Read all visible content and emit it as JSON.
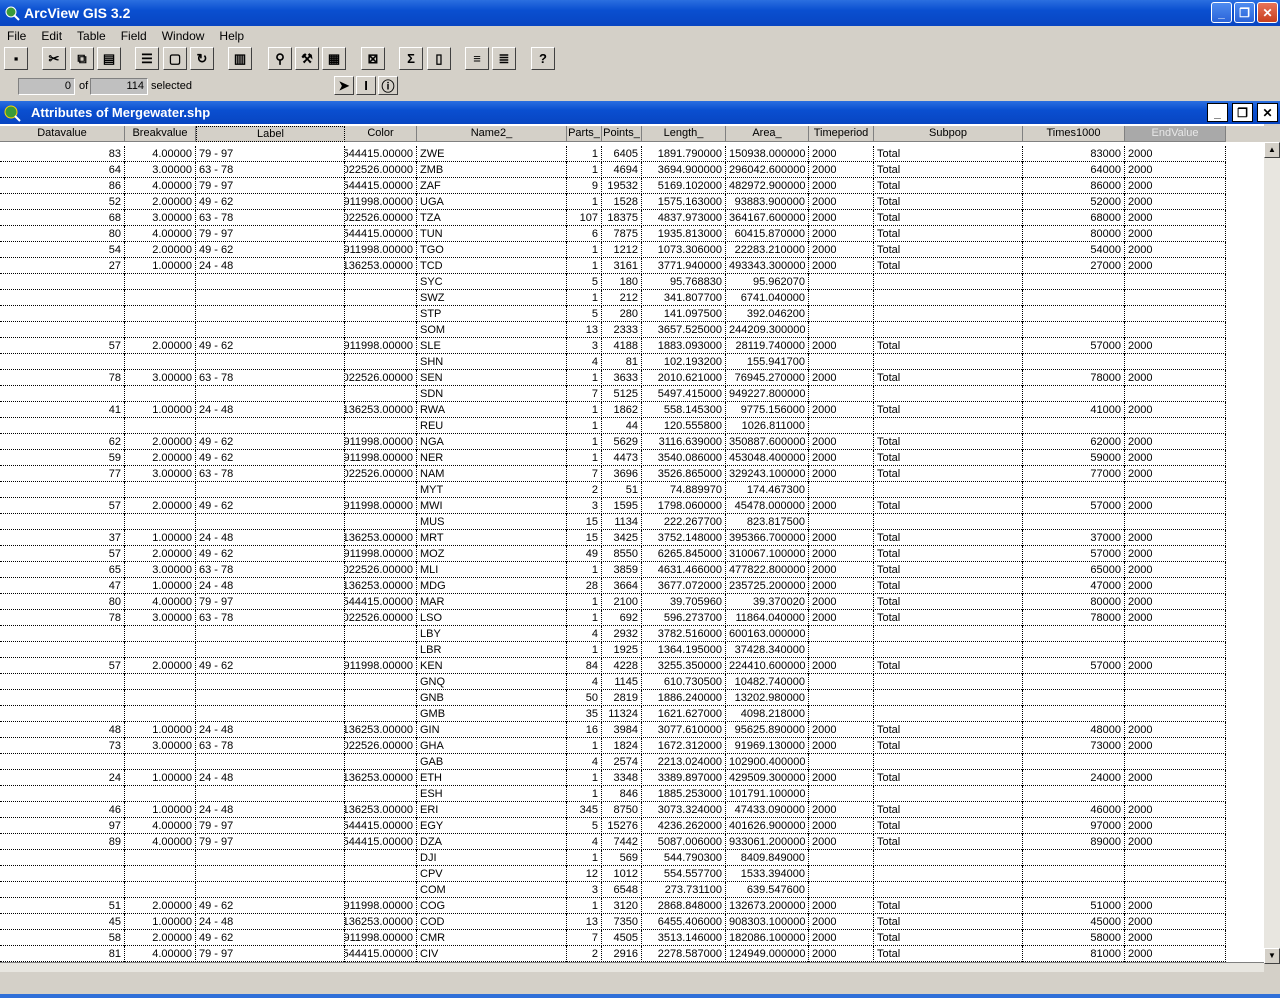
{
  "app": {
    "title": "ArcView GIS 3.2",
    "brand_color": "#0a4fd0"
  },
  "menu": [
    "File",
    "Edit",
    "Table",
    "Field",
    "Window",
    "Help"
  ],
  "toolbar": {
    "icons": [
      "save-icon",
      "cut-icon",
      "copy-icon",
      "paste-icon",
      "table-properties-icon",
      "select-all-icon",
      "refresh-icon",
      "chart-icon",
      "find-icon",
      "query-icon",
      "promote-icon",
      "field-calc-icon",
      "sum-icon",
      "summarize-icon",
      "sort-ascending-icon",
      "sort-descending-icon",
      "help-icon"
    ],
    "tools": [
      "pointer-tool-icon",
      "edit-tool-icon",
      "identify-tool-icon"
    ]
  },
  "status": {
    "selected_count": "0",
    "of_label": "of",
    "total_count": "114",
    "selected_label": "selected"
  },
  "table": {
    "title": "Attributes of Mergewater.shp",
    "columns": [
      "Datavalue",
      "Breakvalue",
      "Label",
      "Color",
      "Name2_",
      "Parts_",
      "Points_",
      "Length_",
      "Area_",
      "Timeperiod",
      "Subpop",
      "Times1000",
      "EndValue"
    ],
    "rows": [
      [
        "83",
        "4.00000",
        "79 - 97",
        "544415.00000",
        "ZWE",
        "1",
        "6405",
        "1891.790000",
        "150938.000000",
        "2000",
        "Total",
        "83000",
        "2000"
      ],
      [
        "64",
        "3.00000",
        "63 - 78",
        "022526.00000",
        "ZMB",
        "1",
        "4694",
        "3694.900000",
        "296042.600000",
        "2000",
        "Total",
        "64000",
        "2000"
      ],
      [
        "86",
        "4.00000",
        "79 - 97",
        "544415.00000",
        "ZAF",
        "9",
        "19532",
        "5169.102000",
        "482972.900000",
        "2000",
        "Total",
        "86000",
        "2000"
      ],
      [
        "52",
        "2.00000",
        "49 - 62",
        "911998.00000",
        "UGA",
        "1",
        "1528",
        "1575.163000",
        "93883.900000",
        "2000",
        "Total",
        "52000",
        "2000"
      ],
      [
        "68",
        "3.00000",
        "63 - 78",
        "022526.00000",
        "TZA",
        "107",
        "18375",
        "4837.973000",
        "364167.600000",
        "2000",
        "Total",
        "68000",
        "2000"
      ],
      [
        "80",
        "4.00000",
        "79 - 97",
        "544415.00000",
        "TUN",
        "6",
        "7875",
        "1935.813000",
        "60415.870000",
        "2000",
        "Total",
        "80000",
        "2000"
      ],
      [
        "54",
        "2.00000",
        "49 - 62",
        "911998.00000",
        "TGO",
        "1",
        "1212",
        "1073.306000",
        "22283.210000",
        "2000",
        "Total",
        "54000",
        "2000"
      ],
      [
        "27",
        "1.00000",
        "24 - 48",
        "136253.00000",
        "TCD",
        "1",
        "3161",
        "3771.940000",
        "493343.300000",
        "2000",
        "Total",
        "27000",
        "2000"
      ],
      [
        "",
        "",
        "",
        "",
        "SYC",
        "5",
        "180",
        "95.768830",
        "95.962070",
        "",
        "",
        "",
        ""
      ],
      [
        "",
        "",
        "",
        "",
        "SWZ",
        "1",
        "212",
        "341.807700",
        "6741.040000",
        "",
        "",
        "",
        ""
      ],
      [
        "",
        "",
        "",
        "",
        "STP",
        "5",
        "280",
        "141.097500",
        "392.046200",
        "",
        "",
        "",
        ""
      ],
      [
        "",
        "",
        "",
        "",
        "SOM",
        "13",
        "2333",
        "3657.525000",
        "244209.300000",
        "",
        "",
        "",
        ""
      ],
      [
        "57",
        "2.00000",
        "49 - 62",
        "911998.00000",
        "SLE",
        "3",
        "4188",
        "1883.093000",
        "28119.740000",
        "2000",
        "Total",
        "57000",
        "2000"
      ],
      [
        "",
        "",
        "",
        "",
        "SHN",
        "4",
        "81",
        "102.193200",
        "155.941700",
        "",
        "",
        "",
        ""
      ],
      [
        "78",
        "3.00000",
        "63 - 78",
        "022526.00000",
        "SEN",
        "1",
        "3633",
        "2010.621000",
        "76945.270000",
        "2000",
        "Total",
        "78000",
        "2000"
      ],
      [
        "",
        "",
        "",
        "",
        "SDN",
        "7",
        "5125",
        "5497.415000",
        "949227.800000",
        "",
        "",
        "",
        ""
      ],
      [
        "41",
        "1.00000",
        "24 - 48",
        "136253.00000",
        "RWA",
        "1",
        "1862",
        "558.145300",
        "9775.156000",
        "2000",
        "Total",
        "41000",
        "2000"
      ],
      [
        "",
        "",
        "",
        "",
        "REU",
        "1",
        "44",
        "120.555800",
        "1026.811000",
        "",
        "",
        "",
        ""
      ],
      [
        "62",
        "2.00000",
        "49 - 62",
        "911998.00000",
        "NGA",
        "1",
        "5629",
        "3116.639000",
        "350887.600000",
        "2000",
        "Total",
        "62000",
        "2000"
      ],
      [
        "59",
        "2.00000",
        "49 - 62",
        "911998.00000",
        "NER",
        "1",
        "4473",
        "3540.086000",
        "453048.400000",
        "2000",
        "Total",
        "59000",
        "2000"
      ],
      [
        "77",
        "3.00000",
        "63 - 78",
        "022526.00000",
        "NAM",
        "7",
        "3696",
        "3526.865000",
        "329243.100000",
        "2000",
        "Total",
        "77000",
        "2000"
      ],
      [
        "",
        "",
        "",
        "",
        "MYT",
        "2",
        "51",
        "74.889970",
        "174.467300",
        "",
        "",
        "",
        ""
      ],
      [
        "57",
        "2.00000",
        "49 - 62",
        "911998.00000",
        "MWI",
        "3",
        "1595",
        "1798.060000",
        "45478.000000",
        "2000",
        "Total",
        "57000",
        "2000"
      ],
      [
        "",
        "",
        "",
        "",
        "MUS",
        "15",
        "1134",
        "222.267700",
        "823.817500",
        "",
        "",
        "",
        ""
      ],
      [
        "37",
        "1.00000",
        "24 - 48",
        "136253.00000",
        "MRT",
        "15",
        "3425",
        "3752.148000",
        "395366.700000",
        "2000",
        "Total",
        "37000",
        "2000"
      ],
      [
        "57",
        "2.00000",
        "49 - 62",
        "911998.00000",
        "MOZ",
        "49",
        "8550",
        "6265.845000",
        "310067.100000",
        "2000",
        "Total",
        "57000",
        "2000"
      ],
      [
        "65",
        "3.00000",
        "63 - 78",
        "022526.00000",
        "MLI",
        "1",
        "3859",
        "4631.466000",
        "477822.800000",
        "2000",
        "Total",
        "65000",
        "2000"
      ],
      [
        "47",
        "1.00000",
        "24 - 48",
        "136253.00000",
        "MDG",
        "28",
        "3664",
        "3677.072000",
        "235725.200000",
        "2000",
        "Total",
        "47000",
        "2000"
      ],
      [
        "80",
        "4.00000",
        "79 - 97",
        "544415.00000",
        "MAR",
        "1",
        "2100",
        "39.705960",
        "39.370020",
        "2000",
        "Total",
        "80000",
        "2000"
      ],
      [
        "78",
        "3.00000",
        "63 - 78",
        "022526.00000",
        "LSO",
        "1",
        "692",
        "596.273700",
        "11864.040000",
        "2000",
        "Total",
        "78000",
        "2000"
      ],
      [
        "",
        "",
        "",
        "",
        "LBY",
        "4",
        "2932",
        "3782.516000",
        "600163.000000",
        "",
        "",
        "",
        ""
      ],
      [
        "",
        "",
        "",
        "",
        "LBR",
        "1",
        "1925",
        "1364.195000",
        "37428.340000",
        "",
        "",
        "",
        ""
      ],
      [
        "57",
        "2.00000",
        "49 - 62",
        "911998.00000",
        "KEN",
        "84",
        "4228",
        "3255.350000",
        "224410.600000",
        "2000",
        "Total",
        "57000",
        "2000"
      ],
      [
        "",
        "",
        "",
        "",
        "GNQ",
        "4",
        "1145",
        "610.730500",
        "10482.740000",
        "",
        "",
        "",
        ""
      ],
      [
        "",
        "",
        "",
        "",
        "GNB",
        "50",
        "2819",
        "1886.240000",
        "13202.980000",
        "",
        "",
        "",
        ""
      ],
      [
        "",
        "",
        "",
        "",
        "GMB",
        "35",
        "11324",
        "1621.627000",
        "4098.218000",
        "",
        "",
        "",
        ""
      ],
      [
        "48",
        "1.00000",
        "24 - 48",
        "136253.00000",
        "GIN",
        "16",
        "3984",
        "3077.610000",
        "95625.890000",
        "2000",
        "Total",
        "48000",
        "2000"
      ],
      [
        "73",
        "3.00000",
        "63 - 78",
        "022526.00000",
        "GHA",
        "1",
        "1824",
        "1672.312000",
        "91969.130000",
        "2000",
        "Total",
        "73000",
        "2000"
      ],
      [
        "",
        "",
        "",
        "",
        "GAB",
        "4",
        "2574",
        "2213.024000",
        "102900.400000",
        "",
        "",
        "",
        ""
      ],
      [
        "24",
        "1.00000",
        "24 - 48",
        "136253.00000",
        "ETH",
        "1",
        "3348",
        "3389.897000",
        "429509.300000",
        "2000",
        "Total",
        "24000",
        "2000"
      ],
      [
        "",
        "",
        "",
        "",
        "ESH",
        "1",
        "846",
        "1885.253000",
        "101791.100000",
        "",
        "",
        "",
        ""
      ],
      [
        "46",
        "1.00000",
        "24 - 48",
        "136253.00000",
        "ERI",
        "345",
        "8750",
        "3073.324000",
        "47433.090000",
        "2000",
        "Total",
        "46000",
        "2000"
      ],
      [
        "97",
        "4.00000",
        "79 - 97",
        "544415.00000",
        "EGY",
        "5",
        "15276",
        "4236.262000",
        "401626.900000",
        "2000",
        "Total",
        "97000",
        "2000"
      ],
      [
        "89",
        "4.00000",
        "79 - 97",
        "544415.00000",
        "DZA",
        "4",
        "7442",
        "5087.006000",
        "933061.200000",
        "2000",
        "Total",
        "89000",
        "2000"
      ],
      [
        "",
        "",
        "",
        "",
        "DJI",
        "1",
        "569",
        "544.790300",
        "8409.849000",
        "",
        "",
        "",
        ""
      ],
      [
        "",
        "",
        "",
        "",
        "CPV",
        "12",
        "1012",
        "554.557700",
        "1533.394000",
        "",
        "",
        "",
        ""
      ],
      [
        "",
        "",
        "",
        "",
        "COM",
        "3",
        "6548",
        "273.731100",
        "639.547600",
        "",
        "",
        "",
        ""
      ],
      [
        "51",
        "2.00000",
        "49 - 62",
        "911998.00000",
        "COG",
        "1",
        "3120",
        "2868.848000",
        "132673.200000",
        "2000",
        "Total",
        "51000",
        "2000"
      ],
      [
        "45",
        "1.00000",
        "24 - 48",
        "136253.00000",
        "COD",
        "13",
        "7350",
        "6455.406000",
        "908303.100000",
        "2000",
        "Total",
        "45000",
        "2000"
      ],
      [
        "58",
        "2.00000",
        "49 - 62",
        "911998.00000",
        "CMR",
        "7",
        "4505",
        "3513.146000",
        "182086.100000",
        "2000",
        "Total",
        "58000",
        "2000"
      ],
      [
        "81",
        "4.00000",
        "79 - 97",
        "544415.00000",
        "CIV",
        "2",
        "2916",
        "2278.587000",
        "124949.000000",
        "2000",
        "Total",
        "81000",
        "2000"
      ]
    ]
  }
}
